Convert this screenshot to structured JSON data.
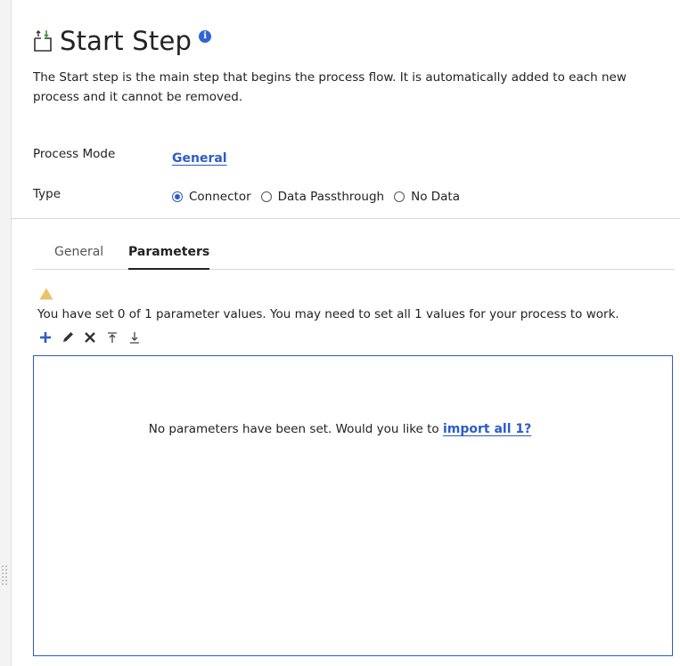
{
  "header": {
    "title": "Start Step",
    "title_icon": "start-step-icon",
    "info_icon": "info-icon",
    "info_glyph": "i"
  },
  "description": "The Start step is the main step that begins the process flow. It is automatically added to each new process and it cannot be removed.",
  "process_mode": {
    "label": "Process Mode",
    "value": "General"
  },
  "type": {
    "label": "Type",
    "options": [
      {
        "label": "Connector",
        "checked": true
      },
      {
        "label": "Data Passthrough",
        "checked": false
      },
      {
        "label": "No Data",
        "checked": false
      }
    ]
  },
  "tabs": [
    {
      "label": "General",
      "active": false
    },
    {
      "label": "Parameters",
      "active": true
    }
  ],
  "warning": {
    "icon": "warning-icon",
    "text": "You have set 0 of 1 parameter values. You may need to set all 1 values for your process to work."
  },
  "toolbar": {
    "icons": [
      "add-icon",
      "edit-icon",
      "delete-icon",
      "move-top-icon",
      "move-bottom-icon"
    ]
  },
  "parameters_panel": {
    "empty_text": "No parameters have been set. Would you like to ",
    "import_link": "import all 1?"
  },
  "colors": {
    "accent": "#2c5cc5",
    "warning": "#e8c36a"
  }
}
